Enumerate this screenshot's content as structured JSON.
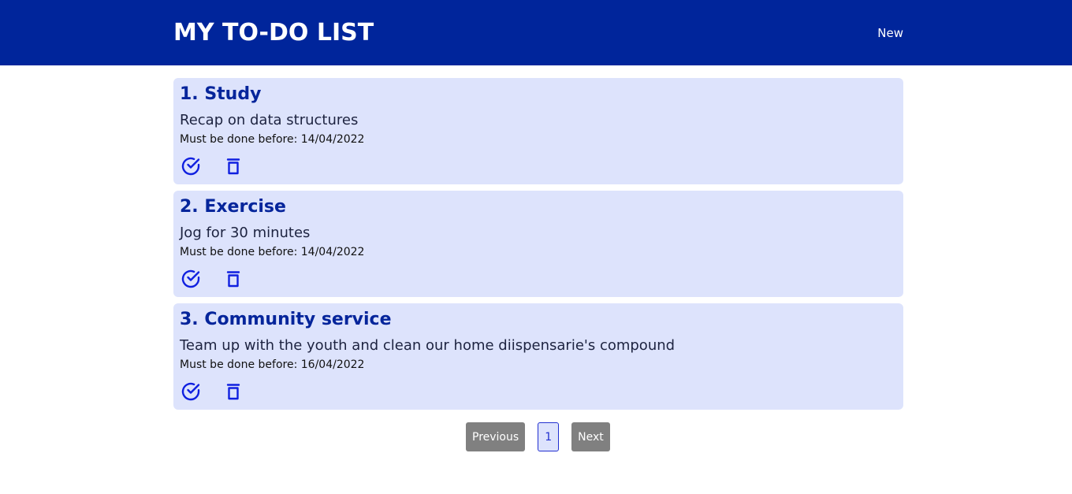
{
  "header": {
    "title": "MY TO-DO LIST",
    "new_label": "New"
  },
  "todos": [
    {
      "title": "1. Study",
      "description": "Recap on data structures",
      "due_label": "Must be done before: ",
      "due_date": "14/04/2022"
    },
    {
      "title": "2. Exercise",
      "description": "Jog for 30 minutes",
      "due_label": "Must be done before: ",
      "due_date": "14/04/2022"
    },
    {
      "title": "3. Community service",
      "description": "Team up with the youth and clean our home diispensarie's compound",
      "due_label": "Must be done before: ",
      "due_date": "16/04/2022"
    }
  ],
  "pagination": {
    "previous_label": "Previous",
    "current_page": "1",
    "next_label": "Next"
  },
  "icons": {
    "complete": "check-circle-icon",
    "delete": "trash-icon"
  },
  "colors": {
    "header_bg": "#00259b",
    "card_bg": "#dde3fc",
    "title_text": "#05259b",
    "icon": "#1020e0",
    "pager_button": "#808080"
  }
}
